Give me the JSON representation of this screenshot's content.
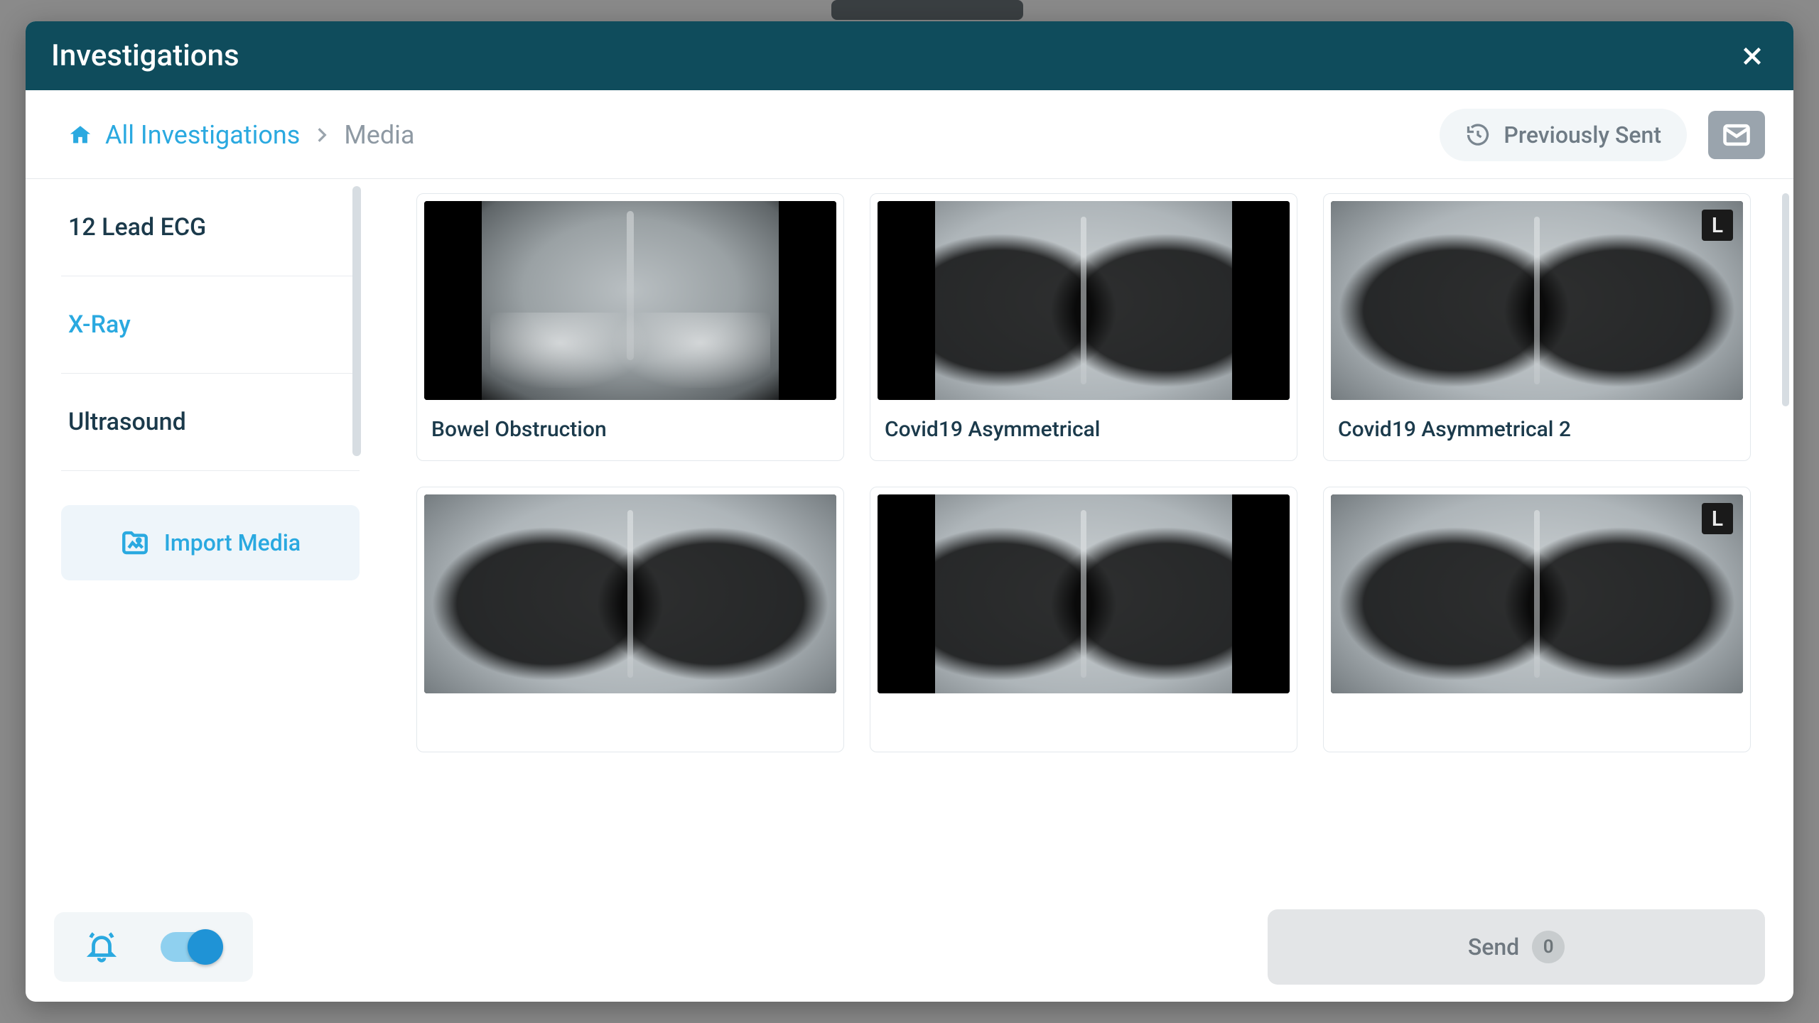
{
  "modal": {
    "title": "Investigations"
  },
  "breadcrumb": {
    "root": "All Investigations",
    "current": "Media"
  },
  "toolbar": {
    "previously_sent": "Previously Sent"
  },
  "categories": [
    {
      "label": "12 Lead ECG",
      "active": false
    },
    {
      "label": "X-Ray",
      "active": true
    },
    {
      "label": "Ultrasound",
      "active": false
    }
  ],
  "import_label": "Import Media",
  "media": [
    {
      "label": "Bowel Obstruction",
      "kind": "abdo",
      "side_bars": true,
      "l_marker": false
    },
    {
      "label": "Covid19 Asymmetrical",
      "kind": "chest",
      "side_bars": true,
      "l_marker": false
    },
    {
      "label": "Covid19 Asymmetrical 2",
      "kind": "chest",
      "side_bars": false,
      "l_marker": true
    },
    {
      "label": "",
      "kind": "chest",
      "side_bars": false,
      "l_marker": false
    },
    {
      "label": "",
      "kind": "chest",
      "side_bars": true,
      "l_marker": false
    },
    {
      "label": "",
      "kind": "chest",
      "side_bars": false,
      "l_marker": true
    }
  ],
  "footer": {
    "send_label": "Send",
    "send_count": "0",
    "l_marker_text": "L"
  }
}
